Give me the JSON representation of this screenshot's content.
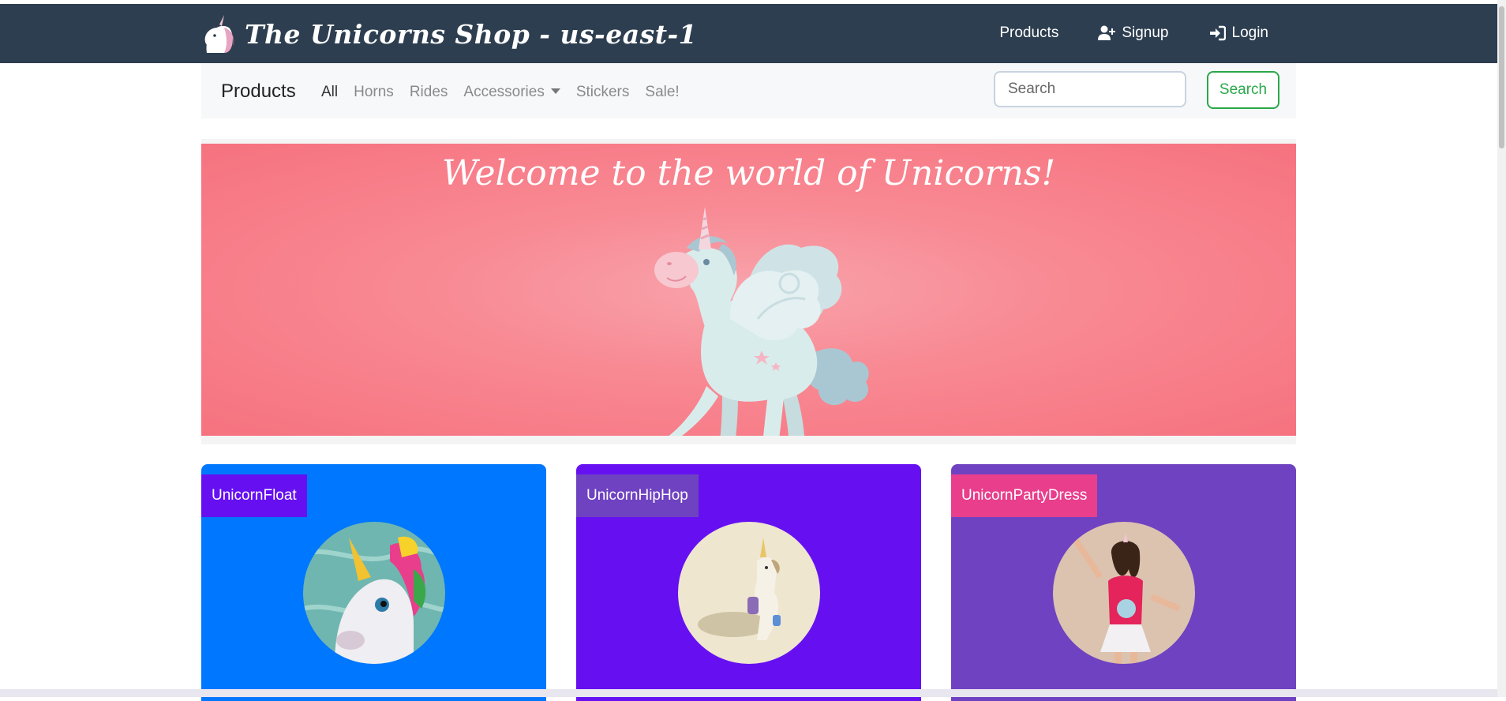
{
  "topbar": {
    "brand": "The Unicorns Shop - us-east-1",
    "nav": {
      "products": "Products",
      "signup": "Signup",
      "login": "Login"
    },
    "background": "#2d3e50"
  },
  "subnav": {
    "title": "Products",
    "links": {
      "all": "All",
      "horns": "Horns",
      "rides": "Rides",
      "accessories": "Accessories",
      "stickers": "Stickers",
      "sale": "Sale!"
    },
    "search": {
      "placeholder": "Search",
      "button": "Search"
    }
  },
  "hero": {
    "title": "Welcome to the world of Unicorns!",
    "color": "#f6727f"
  },
  "products": [
    {
      "name": "UnicornFloat",
      "bg": "#0077ff",
      "tag_bg": "#6610f2"
    },
    {
      "name": "UnicornHipHop",
      "bg": "#6610f2",
      "tag_bg": "#6f42c1"
    },
    {
      "name": "UnicornPartyDress",
      "bg": "#6f42c1",
      "tag_bg": "#e83e8c"
    }
  ],
  "icons": {
    "brand_logo": "unicorn-head-icon",
    "signup": "user-plus-icon",
    "login": "sign-in-icon",
    "accessories_caret": "chevron-down-icon"
  }
}
